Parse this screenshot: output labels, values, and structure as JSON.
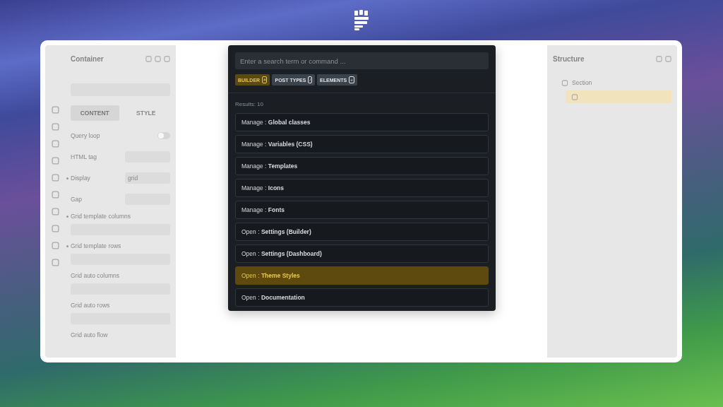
{
  "left_panel": {
    "title": "Container",
    "tabs": [
      {
        "label": "CONTENT",
        "selected": true
      },
      {
        "label": "STYLE",
        "selected": false
      }
    ],
    "controls": [
      {
        "kind": "toggle",
        "label": "Query loop",
        "on": false
      },
      {
        "kind": "field",
        "label": "HTML tag"
      },
      {
        "kind": "field",
        "label": "Display",
        "value": "grid",
        "marked": true
      },
      {
        "kind": "field",
        "label": "Gap"
      },
      {
        "kind": "block",
        "label": "Grid template columns",
        "marked": true
      },
      {
        "kind": "block",
        "label": "Grid template rows",
        "marked": true
      },
      {
        "kind": "block",
        "label": "Grid auto columns"
      },
      {
        "kind": "block",
        "label": "Grid auto rows"
      },
      {
        "kind": "label",
        "label": "Grid auto flow"
      }
    ]
  },
  "palette": {
    "search": {
      "placeholder": "Enter a search term or command ..."
    },
    "filters": [
      {
        "label": "BUILDER",
        "key": "#",
        "selected": true
      },
      {
        "label": "POST TYPES",
        "key": "/",
        "selected": false
      },
      {
        "label": "ELEMENTS",
        "key": "+",
        "selected": false
      }
    ],
    "results_count": "Results: 10",
    "results": [
      {
        "action": "Manage",
        "separator": ":",
        "target": "Global classes",
        "selected": false
      },
      {
        "action": "Manage",
        "separator": ":",
        "target": "Variables (CSS)",
        "selected": false
      },
      {
        "action": "Manage",
        "separator": ":",
        "target": "Templates",
        "selected": false
      },
      {
        "action": "Manage",
        "separator": ":",
        "target": "Icons",
        "selected": false
      },
      {
        "action": "Manage",
        "separator": ":",
        "target": "Fonts",
        "selected": false
      },
      {
        "action": "Open",
        "separator": ":",
        "target": "Settings (Builder)",
        "selected": false
      },
      {
        "action": "Open",
        "separator": ":",
        "target": "Settings (Dashboard)",
        "selected": false
      },
      {
        "action": "Open",
        "separator": ":",
        "target": "Theme Styles",
        "selected": true
      },
      {
        "action": "Open",
        "separator": ":",
        "target": "Documentation",
        "selected": false
      }
    ]
  },
  "structure_panel": {
    "title": "Structure",
    "items": [
      {
        "label": "Section",
        "children": [
          {
            "selected": true
          }
        ]
      }
    ]
  }
}
